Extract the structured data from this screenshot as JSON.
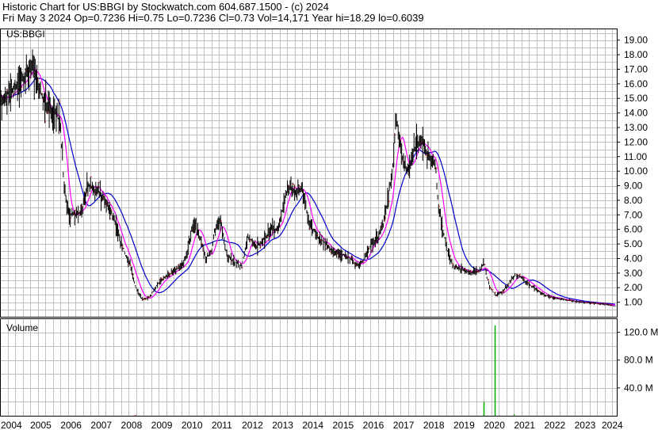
{
  "header": {
    "line1": "Historic Chart for US:BBGI by Stockwatch.com 604.687.1500 - (c) 2024",
    "line2": "Fri May  3 2024   Op=0.7236   Hi=0.75   Lo=0.7236   Cl=0.73   Vol=14,171   Year hi=18.29   lo=0.6039"
  },
  "colors": {
    "price": "#000000",
    "down_tick": "#cc0000",
    "ma_short": "#ff00ff",
    "ma_long": "#0000cc",
    "volume": "#00aa00",
    "grid": "#c0c0c0",
    "frame": "#000000"
  },
  "chart_data": [
    {
      "type": "line",
      "title": "US:BBGI",
      "ylim": [
        0,
        19.8
      ],
      "y_ticks": [
        "1.00",
        "2.00",
        "3.00",
        "4.00",
        "5.00",
        "6.00",
        "7.00",
        "8.00",
        "9.00",
        "10.00",
        "11.00",
        "12.00",
        "13.00",
        "14.00",
        "15.00",
        "16.00",
        "17.00",
        "18.00",
        "19.00"
      ],
      "x_labels": [
        "2004",
        "2005",
        "2006",
        "2007",
        "2008",
        "2009",
        "2010",
        "2011",
        "2012",
        "2013",
        "2014",
        "2015",
        "2016",
        "2017",
        "2018",
        "2019",
        "2020",
        "2021",
        "2022",
        "2023",
        "2024"
      ],
      "series": [
        {
          "x": [
            2004.0,
            2004.3,
            2004.6,
            2004.9,
            2005.1,
            2005.3,
            2005.6,
            2005.9,
            2006.0,
            2006.1,
            2006.2,
            2006.3,
            2006.5,
            2006.7,
            2006.9,
            2007.0,
            2007.3,
            2007.6,
            2007.8,
            2008.0,
            2008.3,
            2008.5,
            2008.7,
            2008.9,
            2009.0,
            2009.2,
            2009.5,
            2009.8,
            2010.0,
            2010.2,
            2010.4,
            2010.6,
            2010.8,
            2011.0,
            2011.1,
            2011.3,
            2011.5,
            2011.8,
            2012.0,
            2012.2,
            2012.5,
            2012.8,
            2013.0,
            2013.2,
            2013.4,
            2013.6,
            2013.8,
            2014.0,
            2014.2,
            2014.5,
            2014.8,
            2015.0,
            2015.3,
            2015.6,
            2015.8,
            2016.0,
            2016.3,
            2016.5,
            2016.7,
            2016.9,
            2017.0,
            2017.1,
            2017.3,
            2017.5,
            2017.7,
            2017.9,
            2018.0,
            2018.2,
            2018.4,
            2018.5,
            2018.6,
            2018.8,
            2019.0,
            2019.3,
            2019.6,
            2019.9,
            2020.0,
            2020.1,
            2020.2,
            2020.4,
            2020.6,
            2020.8,
            2021.0,
            2021.2,
            2021.5,
            2021.8,
            2022.0,
            2022.3,
            2022.6,
            2022.9,
            2023.2,
            2023.5,
            2023.8,
            2024.1,
            2024.35
          ],
          "y": [
            14.5,
            15.5,
            16.0,
            16.8,
            17.3,
            15.5,
            14.2,
            13.8,
            13.0,
            9.5,
            7.8,
            7.0,
            7.0,
            7.2,
            9.0,
            9.0,
            8.5,
            7.5,
            6.5,
            5.0,
            3.5,
            2.0,
            1.2,
            1.3,
            1.5,
            2.2,
            2.8,
            3.2,
            3.5,
            4.5,
            6.5,
            5.5,
            4.0,
            4.5,
            6.0,
            6.5,
            4.2,
            3.7,
            3.5,
            5.5,
            4.8,
            5.5,
            6.0,
            6.0,
            8.0,
            9.0,
            8.5,
            9.0,
            6.5,
            5.5,
            5.0,
            4.5,
            4.3,
            4.0,
            3.5,
            3.8,
            5.0,
            5.5,
            6.5,
            9.0,
            10.5,
            14.0,
            11.0,
            10.0,
            11.5,
            12.0,
            12.0,
            11.0,
            10.5,
            7.5,
            6.5,
            4.5,
            3.5,
            3.2,
            3.0,
            3.2,
            3.8,
            2.8,
            2.0,
            1.5,
            1.7,
            2.2,
            2.8,
            2.8,
            2.2,
            1.8,
            1.5,
            1.3,
            1.2,
            1.1,
            1.0,
            0.95,
            0.9,
            0.85,
            0.73
          ]
        }
      ]
    },
    {
      "type": "bar",
      "title": "Volume",
      "ylim": [
        0,
        140
      ],
      "y_ticks": [
        "40.0 M",
        "80.0 M",
        "120.0 M"
      ],
      "x": [
        2008.45,
        2020.0,
        2020.35,
        2021.0
      ],
      "values": [
        1.0,
        20.0,
        130.0,
        2.0
      ]
    }
  ]
}
